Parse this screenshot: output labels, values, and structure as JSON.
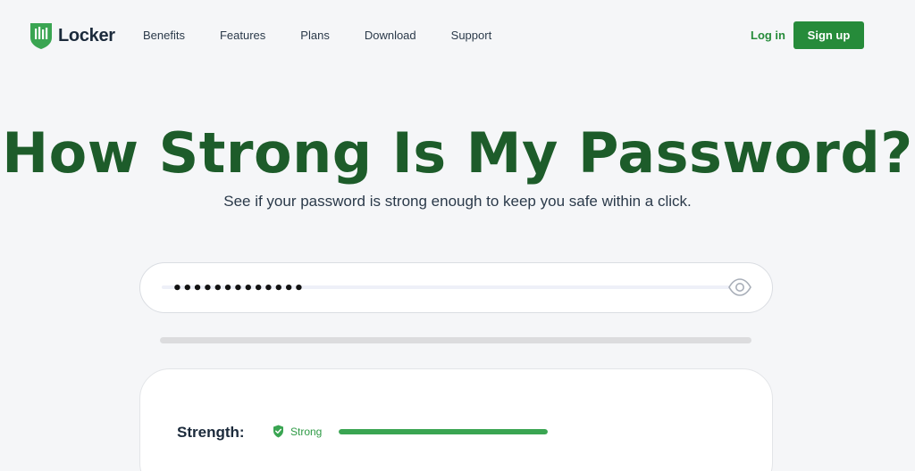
{
  "brand": {
    "name": "Locker"
  },
  "nav": {
    "items": [
      {
        "label": "Benefits"
      },
      {
        "label": "Features"
      },
      {
        "label": "Plans"
      },
      {
        "label": "Download"
      },
      {
        "label": "Support"
      }
    ],
    "login_label": "Log in",
    "signup_label": "Sign up"
  },
  "hero": {
    "title": "How Strong Is My Password?",
    "subtitle": "See if your password is strong enough to keep you safe within a click."
  },
  "password": {
    "value": "•••••••••••••",
    "visibility_icon": "eye-icon"
  },
  "result": {
    "strength_label": "Strength:",
    "strength_value": "Strong",
    "strength_icon": "shield-check-icon",
    "strength_level": 1.0
  },
  "colors": {
    "brand_green": "#268b3a",
    "title_green": "#1d5c2a",
    "strong_green": "#3aa552"
  }
}
